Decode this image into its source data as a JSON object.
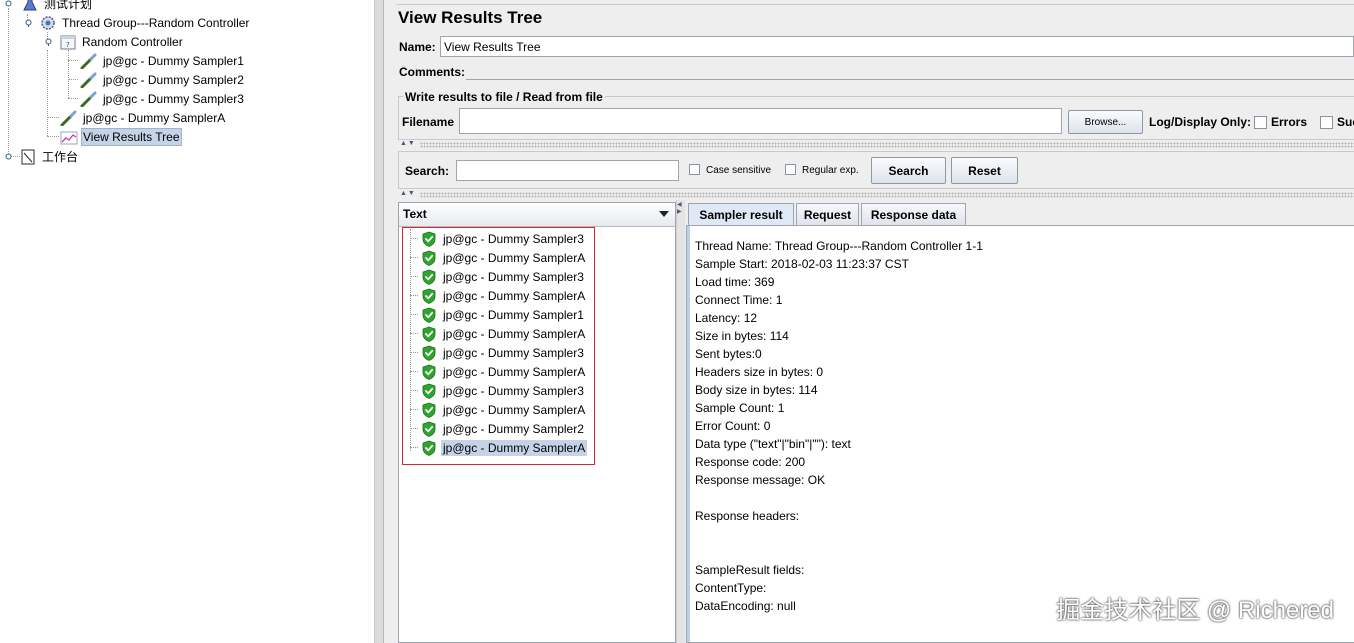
{
  "tree": {
    "test_plan": "测试计划",
    "thread_group": "Thread Group---Random Controller",
    "random_controller": "Random Controller",
    "sampler1": "jp@gc - Dummy Sampler1",
    "sampler2": "jp@gc - Dummy Sampler2",
    "sampler3": "jp@gc - Dummy Sampler3",
    "samplerA": "jp@gc - Dummy SamplerA",
    "view_results_tree": "View Results Tree",
    "workbench": "工作台"
  },
  "panel": {
    "title": "View Results Tree",
    "name_label": "Name:",
    "name_value": "View Results Tree",
    "comments_label": "Comments:",
    "write_group_title": "Write results to file / Read from file",
    "filename_label": "Filename",
    "filename_value": "",
    "browse_label": "Browse...",
    "log_display_label": "Log/Display Only:",
    "errors_label": "Errors",
    "successes_label": "Suc",
    "search_label": "Search:",
    "search_value": "",
    "case_sensitive_label": "Case sensitive",
    "regular_exp_label": "Regular exp.",
    "search_button": "Search",
    "reset_button": "Reset",
    "arrows": "▲▼"
  },
  "results": {
    "header": "Text",
    "items": [
      "jp@gc - Dummy Sampler3",
      "jp@gc - Dummy SamplerA",
      "jp@gc - Dummy Sampler3",
      "jp@gc - Dummy SamplerA",
      "jp@gc - Dummy Sampler1",
      "jp@gc - Dummy SamplerA",
      "jp@gc - Dummy Sampler3",
      "jp@gc - Dummy SamplerA",
      "jp@gc - Dummy Sampler3",
      "jp@gc - Dummy SamplerA",
      "jp@gc - Dummy Sampler2",
      "jp@gc - Dummy SamplerA"
    ],
    "selected_index": 11
  },
  "tabs": [
    "Sampler result",
    "Request",
    "Response data"
  ],
  "active_tab": 0,
  "detail_lines": [
    "Thread Name: Thread Group---Random Controller 1-1",
    "Sample Start: 2018-02-03 11:23:37 CST",
    "Load time: 369",
    "Connect Time: 1",
    "Latency: 12",
    "Size in bytes: 114",
    "Sent bytes:0",
    "Headers size in bytes: 0",
    "Body size in bytes: 114",
    "Sample Count: 1",
    "Error Count: 0",
    "Data type (\"text\"|\"bin\"|\"\"): text",
    "Response code: 200",
    "Response message: OK",
    "",
    "Response headers:",
    "",
    "",
    "SampleResult fields:",
    "ContentType:",
    "DataEncoding: null"
  ],
  "watermark": "掘金技术社区 @ Richered",
  "colors": {
    "panel_bg": "#eeeeee",
    "selection": "#c4d3e6",
    "highlight_box": "#d9262b",
    "success_green": "#2fa52f"
  }
}
